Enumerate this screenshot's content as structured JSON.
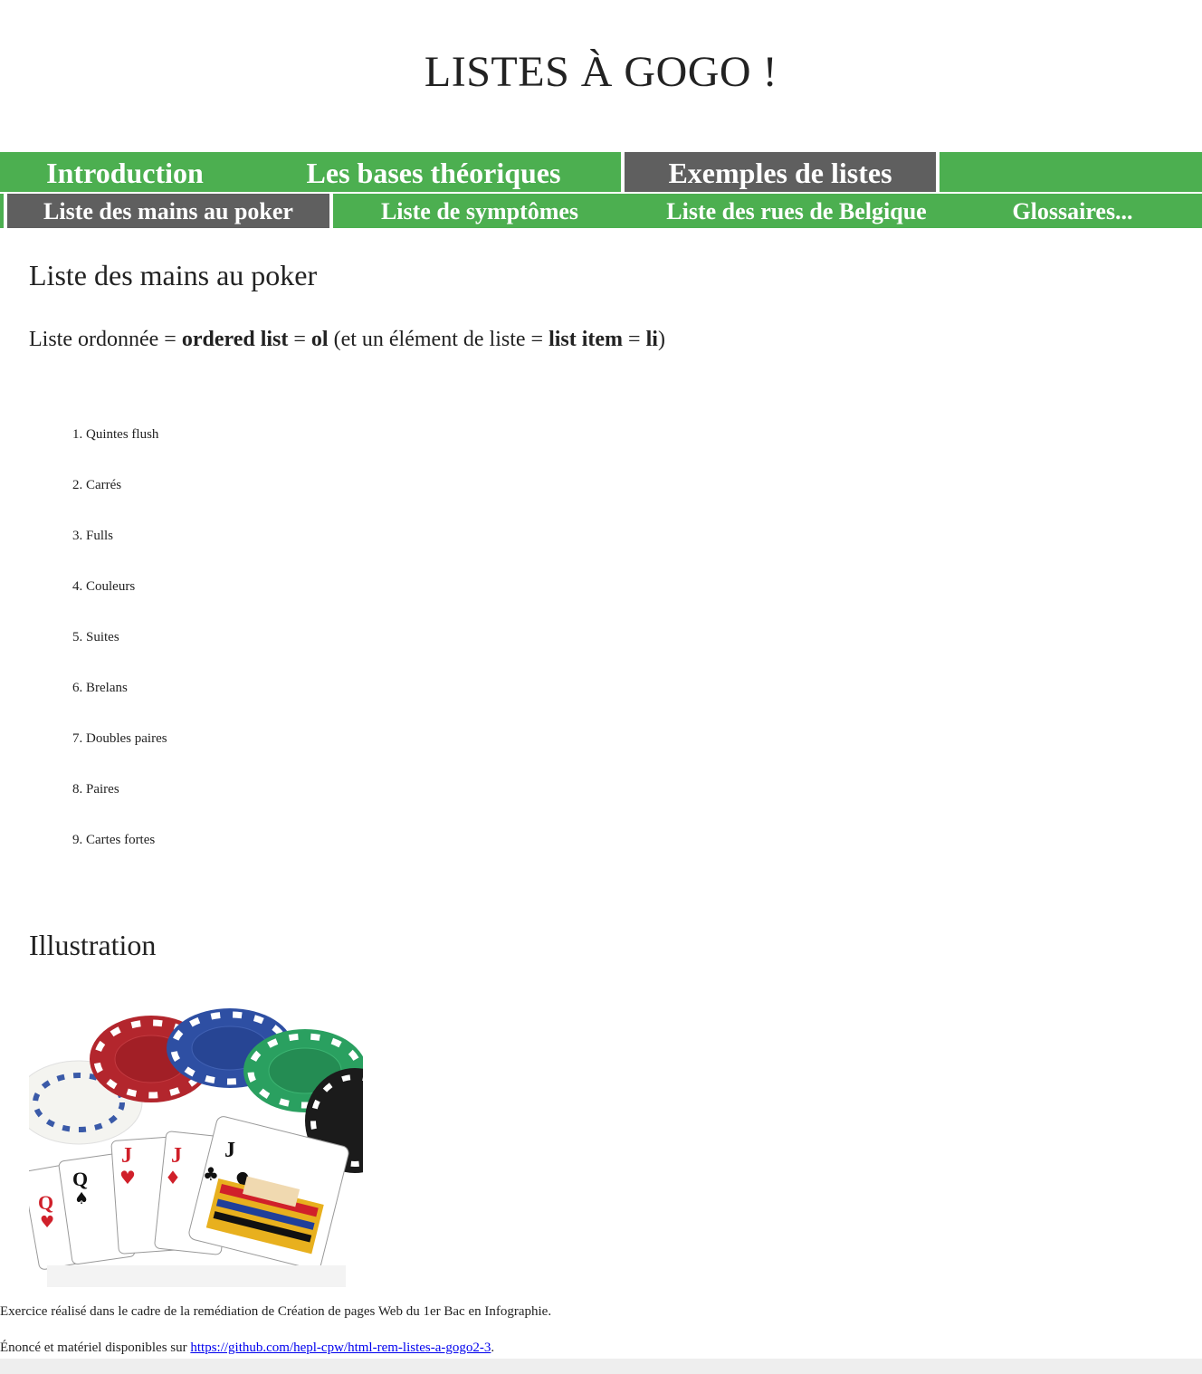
{
  "site": {
    "title": "LISTES À GOGO !"
  },
  "nav_main": [
    {
      "label": "Introduction"
    },
    {
      "label": "Les bases théoriques"
    },
    {
      "label": "Exemples de listes"
    }
  ],
  "nav_sub": [
    {
      "label": "Liste des mains au poker"
    },
    {
      "label": "Liste de symptômes"
    },
    {
      "label": "Liste des rues de Belgique"
    },
    {
      "label": "Glossaires..."
    }
  ],
  "main": {
    "heading": "Liste des mains au poker",
    "intro": {
      "part1": "Liste ordonnée = ",
      "b1": "ordered list",
      "part2": " = ",
      "b2": "ol",
      "part3": " (et un élément de liste = ",
      "b3": "list item",
      "part4": " = ",
      "b4": "li",
      "part5": ")"
    },
    "hands": [
      "1. Quintes flush",
      "2. Carrés",
      "3. Fulls",
      "4. Couleurs",
      "5. Suites",
      "6. Brelans",
      "7. Doubles paires",
      "8. Paires",
      "9. Cartes fortes"
    ],
    "illustration_heading": "Illustration"
  },
  "footer": {
    "line1": "Exercice réalisé dans le cadre de la remédiation de Création de pages Web du 1er Bac en Infographie.",
    "line2_prefix": "Énoncé et matériel disponibles sur ",
    "link": "https://github.com/hepl-cpw/html-rem-listes-a-gogo2-3",
    "line2_suffix": "."
  }
}
